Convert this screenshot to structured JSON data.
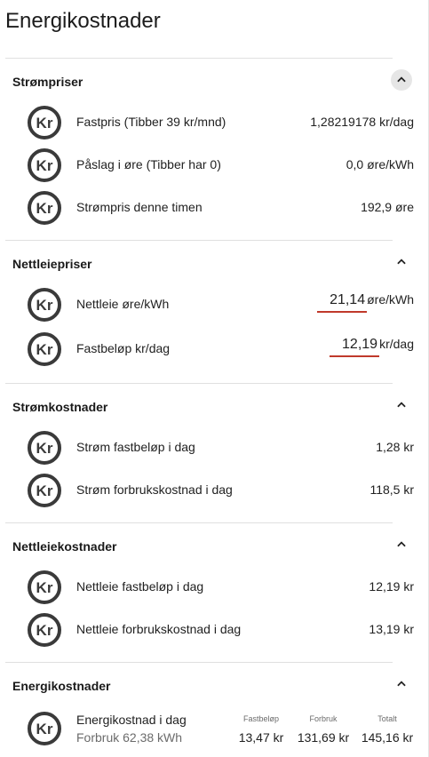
{
  "page_title": "Energikostnader",
  "sections": [
    {
      "title": "Strømpriser",
      "rows": [
        {
          "label": "Fastpris (Tibber 39 kr/mnd)",
          "value": "1,28219178 kr/dag"
        },
        {
          "label": "Påslag i øre (Tibber har 0)",
          "value": "0,0 øre/kWh"
        },
        {
          "label": "Strømpris denne timen",
          "value": "192,9 øre"
        }
      ]
    },
    {
      "title": "Nettleiepriser",
      "rows": [
        {
          "label": "Nettleie øre/kWh",
          "value": "21,14",
          "unit": "øre/kWh"
        },
        {
          "label": "Fastbeløp kr/dag",
          "value": "12,19",
          "unit": "kr/dag"
        }
      ]
    },
    {
      "title": "Strømkostnader",
      "rows": [
        {
          "label": "Strøm fastbeløp i dag",
          "value": "1,28 kr"
        },
        {
          "label": "Strøm forbrukskostnad i dag",
          "value": "118,5 kr"
        }
      ]
    },
    {
      "title": "Nettleiekostnader",
      "rows": [
        {
          "label": "Nettleie fastbeløp i dag",
          "value": "12,19 kr"
        },
        {
          "label": "Nettleie forbrukskostnad i dag",
          "value": "13,19 kr"
        }
      ]
    },
    {
      "title": "Energikostnader",
      "summary": {
        "label": "Energikostnad i dag",
        "sub": "Forbruk 62,38 kWh",
        "columns": [
          {
            "head": "Fastbeløp",
            "value": "13,47 kr"
          },
          {
            "head": "Forbruk",
            "value": "131,69 kr"
          },
          {
            "head": "Totalt",
            "value": "145,16 kr"
          }
        ]
      }
    }
  ],
  "icons": {
    "row_icon": "kr-currency-icon",
    "collapse_icon": "chevron-up-icon"
  },
  "colors": {
    "accent_underline": "#c0392b",
    "icon": "#3a3a3a"
  }
}
